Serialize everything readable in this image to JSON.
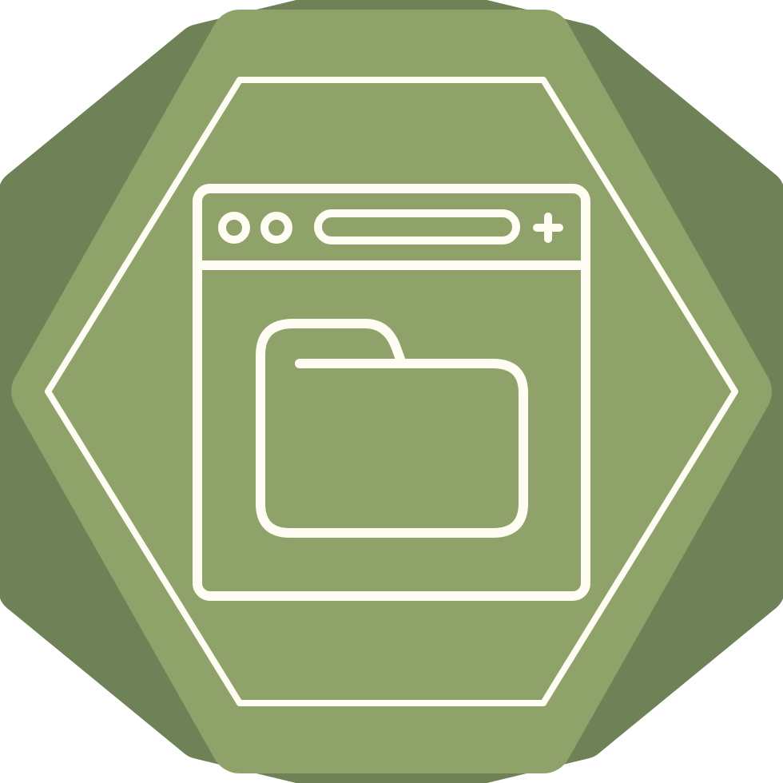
{
  "icon": {
    "name": "browser-folder-icon",
    "colors": {
      "background": "#ffffff",
      "badge_back": "#6f8157",
      "badge_front": "#8fa26a",
      "line": "#fffdf3"
    }
  }
}
